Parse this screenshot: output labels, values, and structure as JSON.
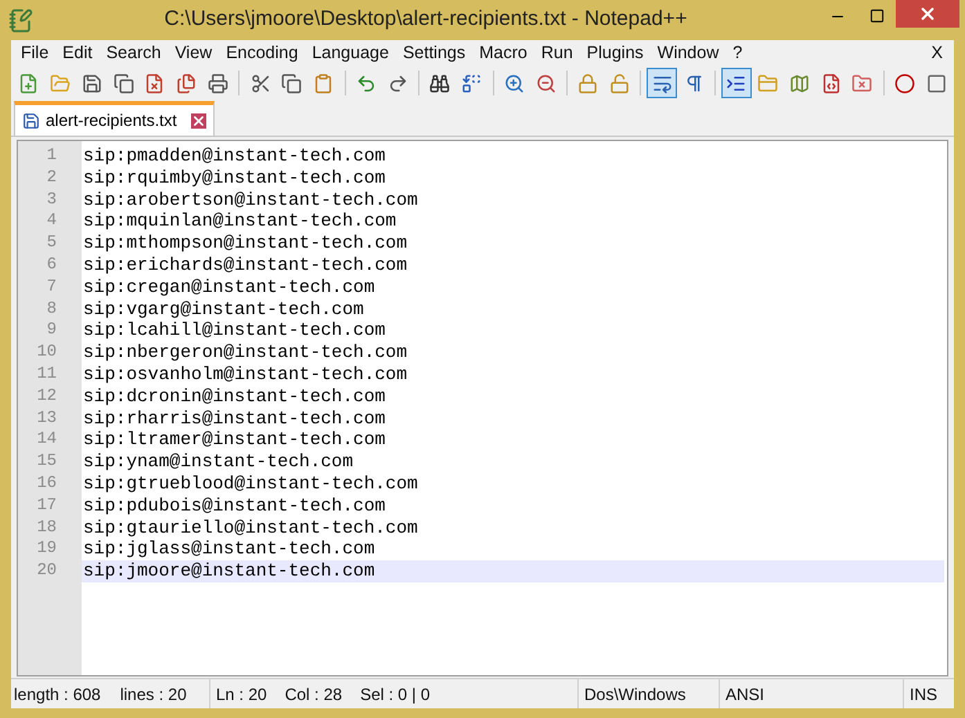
{
  "window": {
    "title": "C:\\Users\\jmoore\\Desktop\\alert-recipients.txt - Notepad++"
  },
  "menu": [
    "File",
    "Edit",
    "Search",
    "View",
    "Encoding",
    "Language",
    "Settings",
    "Macro",
    "Run",
    "Plugins",
    "Window",
    "?"
  ],
  "menu_close": "X",
  "toolbar": [
    [
      {
        "on": false
      },
      {
        "on": false
      },
      {
        "on": false
      },
      {
        "on": false
      },
      {
        "on": false
      },
      {
        "on": false
      },
      {
        "on": false
      }
    ],
    [
      {
        "on": false
      },
      {
        "on": false
      },
      {
        "on": false
      }
    ],
    [
      {
        "on": false
      },
      {
        "on": false
      }
    ],
    [
      {
        "on": false
      },
      {
        "on": false
      }
    ],
    [
      {
        "on": false
      },
      {
        "on": false
      }
    ],
    [
      {
        "on": false
      },
      {
        "on": false
      }
    ],
    [
      {
        "on": true
      },
      {
        "on": false
      }
    ],
    [
      {
        "on": true
      },
      {
        "on": false
      },
      {
        "on": false
      },
      {
        "on": false
      },
      {
        "on": false
      }
    ],
    [
      {
        "on": false
      },
      {
        "on": false
      }
    ]
  ],
  "tabs": [
    {
      "label": "alert-recipients.txt",
      "selected": true
    }
  ],
  "lines": [
    {
      "number": "1",
      "text": "sip:pmadden@instant-tech.com",
      "current": false
    },
    {
      "number": "2",
      "text": "sip:rquimby@instant-tech.com",
      "current": false
    },
    {
      "number": "3",
      "text": "sip:arobertson@instant-tech.com",
      "current": false
    },
    {
      "number": "4",
      "text": "sip:mquinlan@instant-tech.com",
      "current": false
    },
    {
      "number": "5",
      "text": "sip:mthompson@instant-tech.com",
      "current": false
    },
    {
      "number": "6",
      "text": "sip:erichards@instant-tech.com",
      "current": false
    },
    {
      "number": "7",
      "text": "sip:cregan@instant-tech.com",
      "current": false
    },
    {
      "number": "8",
      "text": "sip:vgarg@instant-tech.com",
      "current": false
    },
    {
      "number": "9",
      "text": "sip:lcahill@instant-tech.com",
      "current": false
    },
    {
      "number": "10",
      "text": "sip:nbergeron@instant-tech.com",
      "current": false
    },
    {
      "number": "11",
      "text": "sip:osvanholm@instant-tech.com",
      "current": false
    },
    {
      "number": "12",
      "text": "sip:dcronin@instant-tech.com",
      "current": false
    },
    {
      "number": "13",
      "text": "sip:rharris@instant-tech.com",
      "current": false
    },
    {
      "number": "14",
      "text": "sip:ltramer@instant-tech.com",
      "current": false
    },
    {
      "number": "15",
      "text": "sip:ynam@instant-tech.com",
      "current": false
    },
    {
      "number": "16",
      "text": "sip:gtrueblood@instant-tech.com",
      "current": false
    },
    {
      "number": "17",
      "text": "sip:pdubois@instant-tech.com",
      "current": false
    },
    {
      "number": "18",
      "text": "sip:gtauriello@instant-tech.com",
      "current": false
    },
    {
      "number": "19",
      "text": "sip:jglass@instant-tech.com",
      "current": false
    },
    {
      "number": "20",
      "text": "sip:jmoore@instant-tech.com",
      "current": true
    }
  ],
  "status_bar": {
    "length": "length : 608",
    "lines": "lines : 20",
    "ln": "Ln : 20",
    "col": "Col : 28",
    "sel": "Sel : 0 | 0",
    "eol": "Dos\\Windows",
    "encoding": "ANSI",
    "mode": "INS"
  }
}
